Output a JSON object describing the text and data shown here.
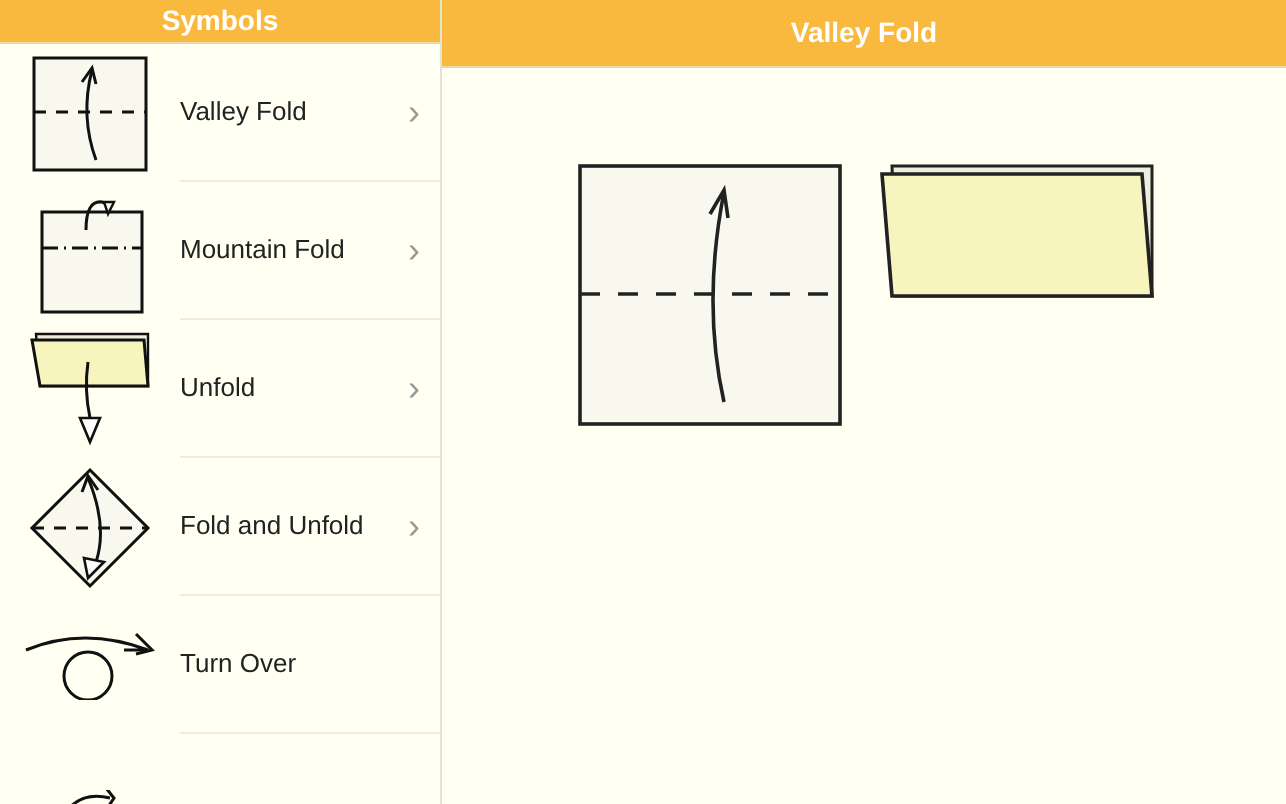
{
  "sidebar": {
    "title": "Symbols",
    "items": [
      {
        "kind": "valley",
        "label": "Valley Fold",
        "chevron": "›"
      },
      {
        "kind": "mountain",
        "label": "Mountain Fold",
        "chevron": "›"
      },
      {
        "kind": "unfold",
        "label": "Unfold",
        "chevron": "›"
      },
      {
        "kind": "fold-unfold",
        "label": "Fold and Unfold",
        "chevron": "›"
      },
      {
        "kind": "turn-over",
        "label": "Turn Over"
      },
      {
        "kind": "rotate"
      }
    ]
  },
  "detail": {
    "title": "Valley Fold",
    "steps": [
      {
        "kind": "valley"
      },
      {
        "kind": "folded"
      }
    ]
  }
}
